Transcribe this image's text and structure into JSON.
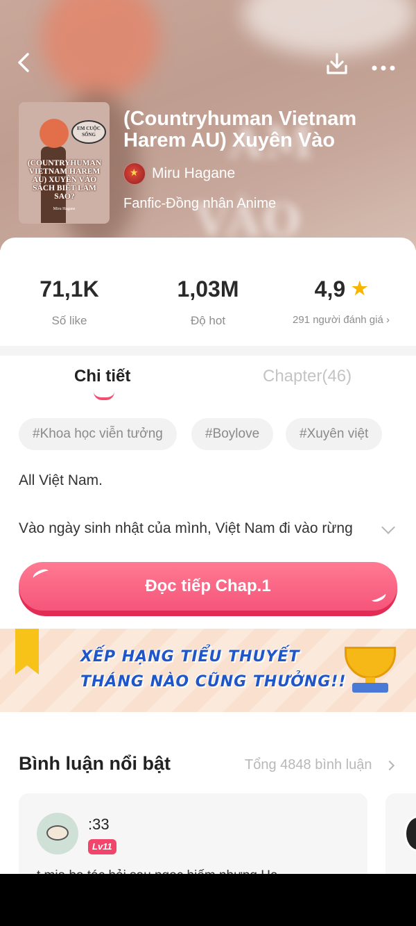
{
  "header": {
    "back_icon": "chevron-left-icon",
    "download_icon": "download-icon",
    "more_icon": "more-dots-icon"
  },
  "cover": {
    "bubble_text": "EM CUỘC SỐNG",
    "title": "(COUNTRYHUMAN VIETNAM HAREM AU) XUYÊN VÀO SÁCH BIẾT LÀM SAO?",
    "author": "Miru Hagane"
  },
  "book": {
    "title": "(Countryhuman Vietnam Harem AU) Xuyên Vào",
    "author": "Miru Hagane",
    "genre": "Fanfic-Đồng nhân Anime"
  },
  "stats": {
    "likes_value": "71,1K",
    "likes_label": "Số like",
    "hot_value": "1,03M",
    "hot_label": "Độ hot",
    "rating_value": "4,9",
    "rating_label": "291 người đánh giá"
  },
  "tabs": [
    {
      "label": "Chi tiết",
      "active": true
    },
    {
      "label": "Chapter(46)",
      "active": false
    }
  ],
  "tags": [
    "#Khoa học viễn tưởng",
    "#Boylove",
    "#Xuyên việt"
  ],
  "description": {
    "line1": "All Việt Nam.",
    "line2": "Vào ngày sinh nhật của mình, Việt Nam đi vào rừng"
  },
  "read_button": {
    "label": "Đọc tiếp Chap.1"
  },
  "banner": {
    "line1": "XẾP HẠNG TIỂU THUYẾT",
    "line2": "THÁNG NÀO CŨNG THƯỞNG!!"
  },
  "comments": {
    "title": "Bình luận nổi bật",
    "total": "Tổng 4848 bình luận",
    "items": [
      {
        "user": ":33",
        "level": "Lv11",
        "text": "t mịa ba tác hỏi sau ngọc hiếm nhưng Hạ"
      }
    ]
  },
  "colors": {
    "accent": "#f24f6e",
    "button": "#f5557a",
    "star": "#f7b500",
    "banner_text": "#2056c8"
  }
}
